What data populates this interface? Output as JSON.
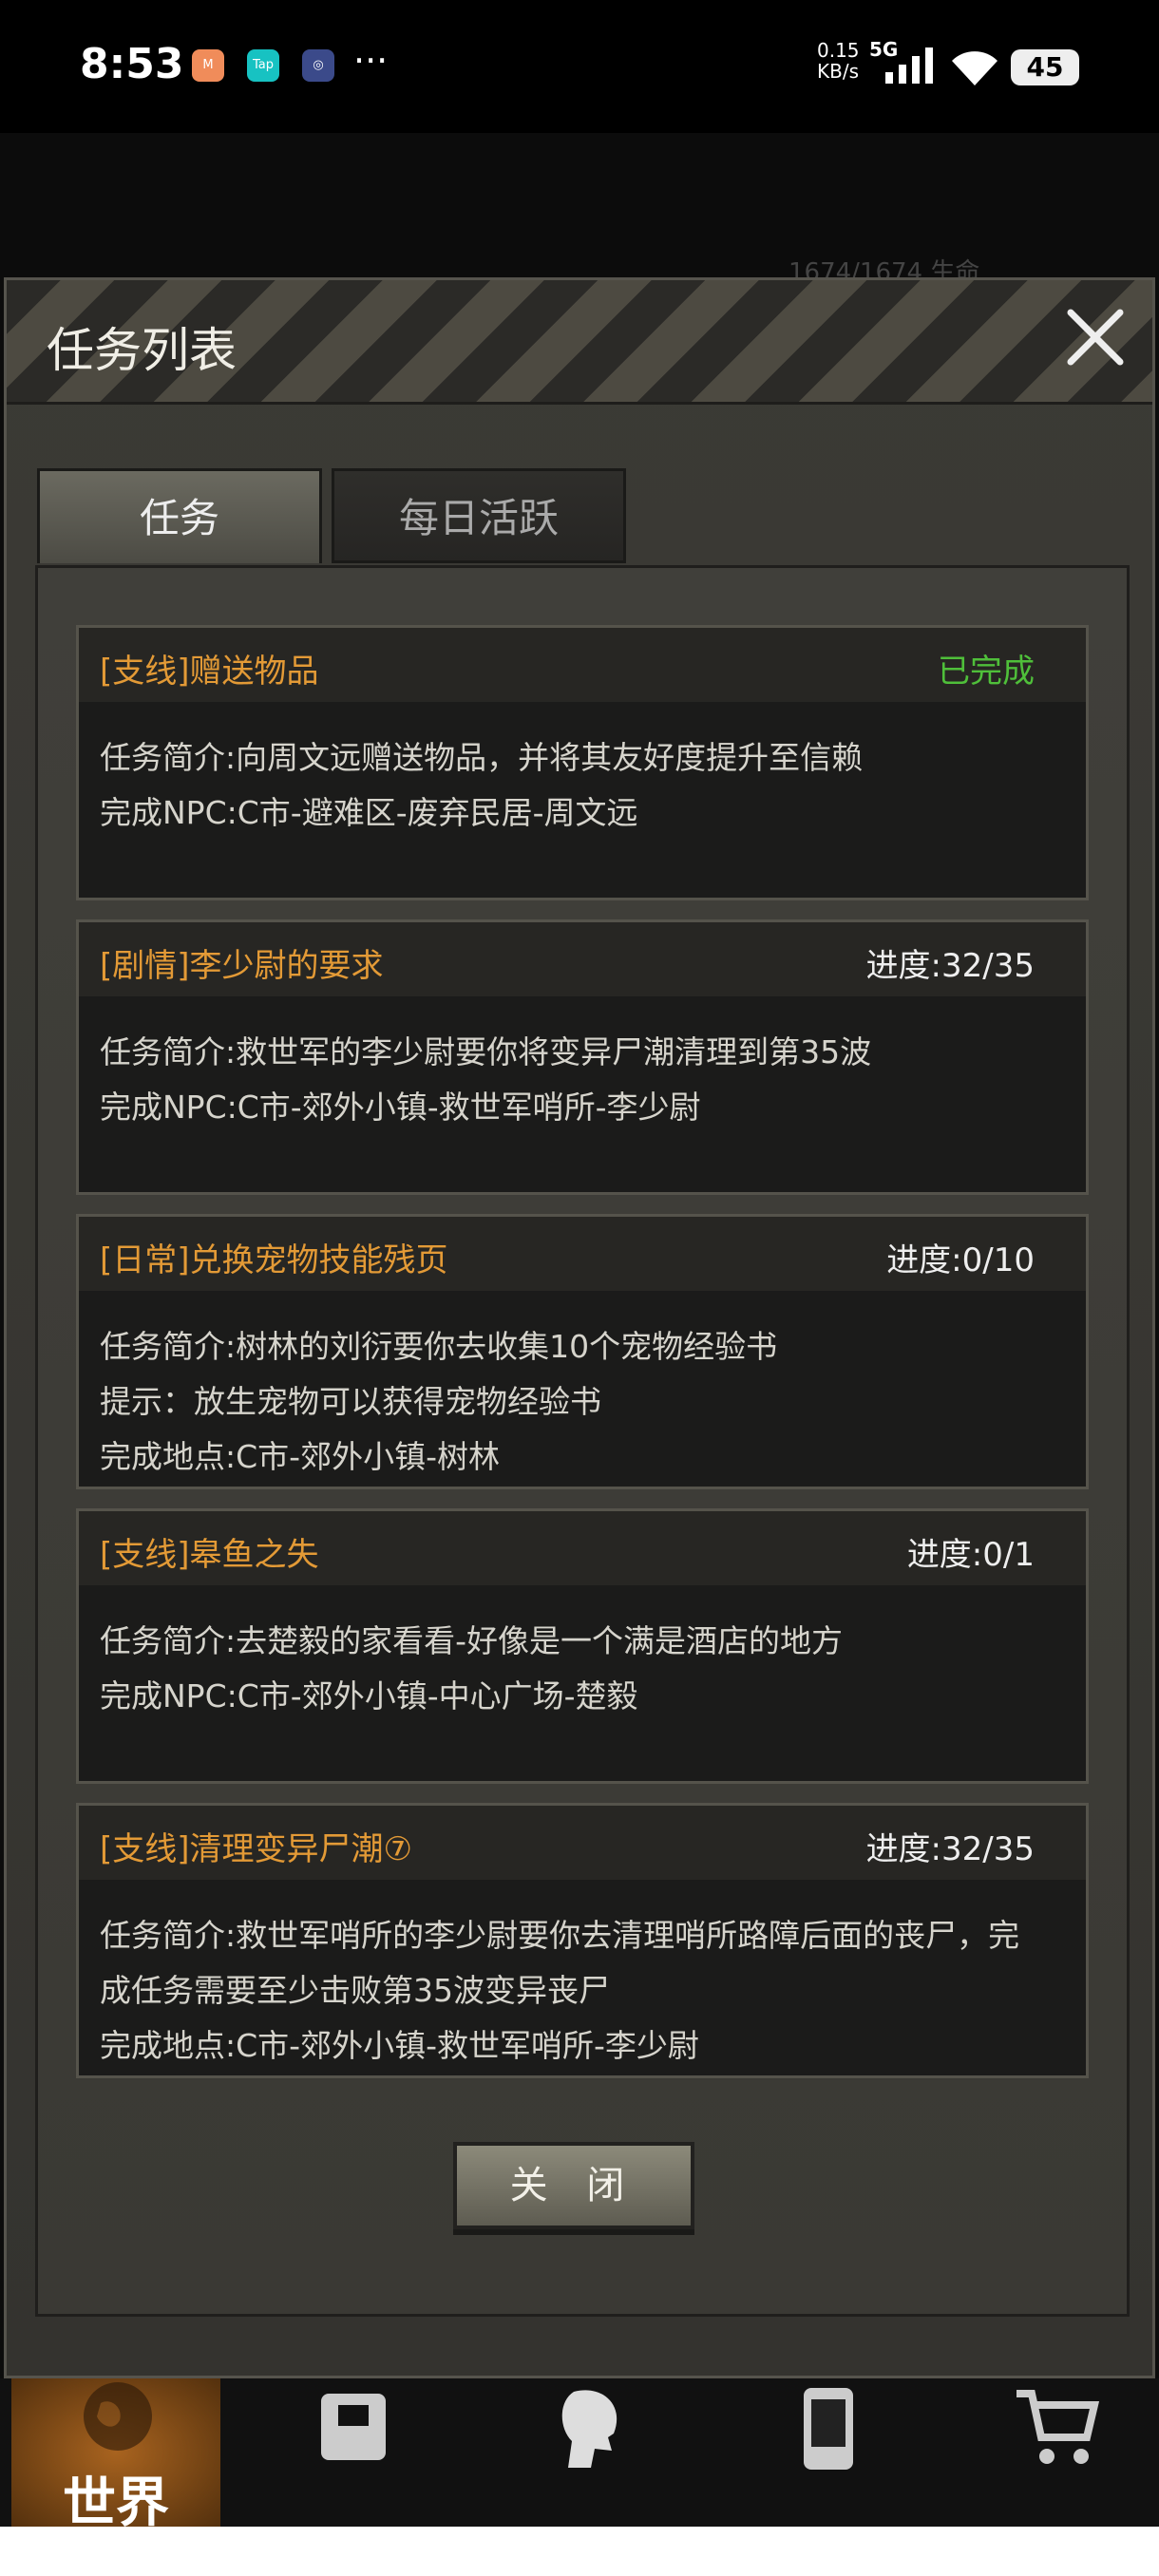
{
  "status_bar": {
    "time": "8:53",
    "speed_value": "0.15",
    "speed_unit": "KB/s",
    "network": "5G",
    "battery": "45",
    "apps": [
      "mi-icon",
      "taptap-icon",
      "browser-icon"
    ],
    "more": "···"
  },
  "background": {
    "stat": "1674/1674    生命"
  },
  "dialog": {
    "title": "任务列表",
    "tabs": [
      {
        "label": "任务",
        "active": true
      },
      {
        "label": "每日活跃",
        "active": false
      }
    ],
    "close_button": "关 闭"
  },
  "tasks": [
    {
      "title": "[支线]赠送物品",
      "status": "已完成",
      "lines": [
        "任务简介:向周文远赠送物品，并将其友好度提升至信赖",
        "完成NPC:C市-避难区-废弃民居-周文远"
      ]
    },
    {
      "title": "[剧情]李少尉的要求",
      "status": "进度:32/35",
      "lines": [
        "任务简介:救世军的李少尉要你将变异尸潮清理到第35波",
        "完成NPC:C市-郊外小镇-救世军哨所-李少尉"
      ]
    },
    {
      "title": "[日常]兑换宠物技能残页",
      "status": "进度:0/10",
      "lines": [
        "任务简介:树林的刘衍要你去收集10个宠物经验书",
        "提示：放生宠物可以获得宠物经验书",
        "完成地点:C市-郊外小镇-树林"
      ]
    },
    {
      "title": "[支线]皋鱼之失",
      "status": "进度:0/1",
      "lines": [
        "任务简介:去楚毅的家看看-好像是一个满是酒店的地方",
        "完成NPC:C市-郊外小镇-中心广场-楚毅"
      ]
    },
    {
      "title": "[支线]清理变异尸潮⑦",
      "status": "进度:32/35",
      "lines": [
        "任务简介:救世军哨所的李少尉要你去清理哨所路障后面的丧尸，完",
        "成任务需要至少击败第35波变异丧尸",
        "完成地点:C市-郊外小镇-救世军哨所-李少尉"
      ]
    }
  ],
  "bottom_nav": [
    {
      "label": "世界",
      "icon": "globe-icon"
    },
    {
      "icon": "backpack-icon"
    },
    {
      "icon": "character-head-icon"
    },
    {
      "icon": "phone-icon"
    },
    {
      "icon": "cart-icon"
    }
  ],
  "colors": {
    "task_title": "#e39a36",
    "completed": "#4fbf3a",
    "accent_nav": "#a8631f"
  }
}
